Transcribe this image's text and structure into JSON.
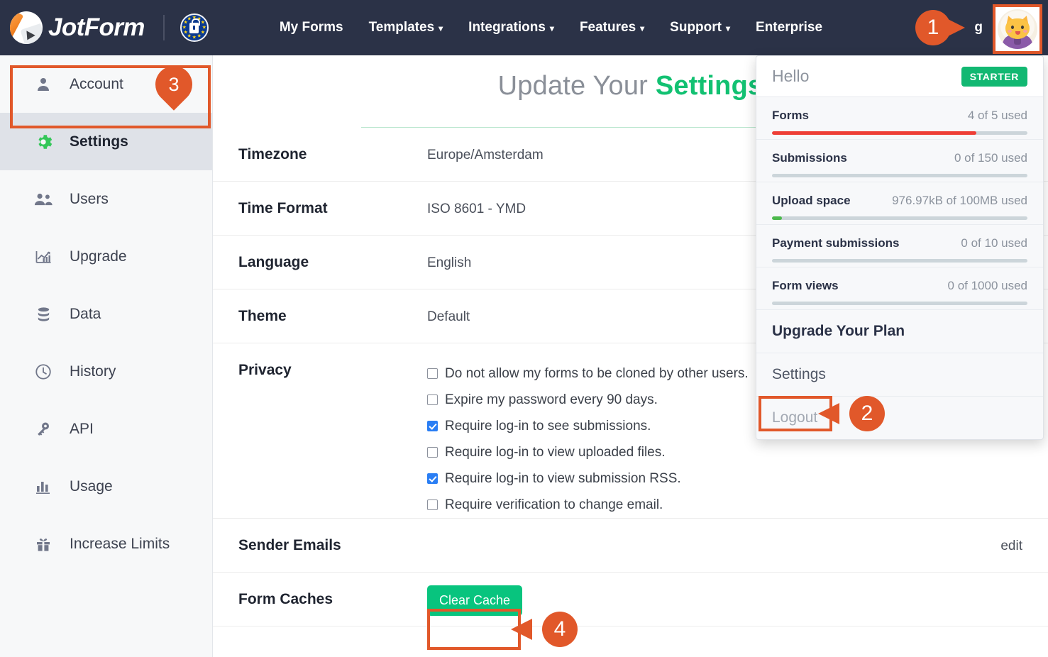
{
  "brand": {
    "name": "JotForm",
    "gdpr_badge": "gdpr-eu-lock"
  },
  "topnav": {
    "links": [
      {
        "label": "My Forms",
        "has_caret": false
      },
      {
        "label": "Templates",
        "has_caret": true
      },
      {
        "label": "Integrations",
        "has_caret": true
      },
      {
        "label": "Features",
        "has_caret": true
      },
      {
        "label": "Support",
        "has_caret": true
      },
      {
        "label": "Enterprise",
        "has_caret": false
      }
    ],
    "username_partial": "g"
  },
  "sidebar": {
    "items": [
      {
        "label": "Account",
        "icon": "person-icon",
        "active": false
      },
      {
        "label": "Settings",
        "icon": "gear-icon",
        "active": true
      },
      {
        "label": "Users",
        "icon": "people-icon",
        "active": false
      },
      {
        "label": "Upgrade",
        "icon": "trending-up-icon",
        "active": false
      },
      {
        "label": "Data",
        "icon": "database-icon",
        "active": false
      },
      {
        "label": "History",
        "icon": "clock-icon",
        "active": false
      },
      {
        "label": "API",
        "icon": "key-icon",
        "active": false
      },
      {
        "label": "Usage",
        "icon": "bar-chart-icon",
        "active": false
      },
      {
        "label": "Increase Limits",
        "icon": "gift-icon",
        "active": false
      }
    ]
  },
  "main": {
    "title_prefix": "Update Your ",
    "title_accent": "Settings",
    "rows": [
      {
        "label": "Timezone",
        "value": "Europe/Amsterdam"
      },
      {
        "label": "Time Format",
        "value": "ISO 8601 - YMD"
      },
      {
        "label": "Language",
        "value": "English"
      },
      {
        "label": "Theme",
        "value": "Default"
      }
    ],
    "privacy": {
      "label": "Privacy",
      "options": [
        {
          "text": "Do not allow my forms to be cloned by other users.",
          "checked": false
        },
        {
          "text": "Expire my password every 90 days.",
          "checked": false
        },
        {
          "text": "Require log-in to see submissions.",
          "checked": true
        },
        {
          "text": "Require log-in to view uploaded files.",
          "checked": false
        },
        {
          "text": "Require log-in to view submission RSS.",
          "checked": true
        },
        {
          "text": "Require verification to change email.",
          "checked": false
        }
      ]
    },
    "sender_emails": {
      "label": "Sender Emails",
      "edit_label": "edit"
    },
    "form_caches": {
      "label": "Form Caches",
      "button_label": "Clear Cache"
    }
  },
  "dropdown": {
    "greeting": "Hello",
    "plan_badge": "STARTER",
    "usage": [
      {
        "name": "Forms",
        "value": "4 of 5 used",
        "percent": 80,
        "color": "#ee3e36"
      },
      {
        "name": "Submissions",
        "value": "0 of 150 used",
        "percent": 0,
        "color": "#12b872"
      },
      {
        "name": "Upload space",
        "value": "976.97kB of 100MB used",
        "percent": 4,
        "color": "#4cb94c"
      },
      {
        "name": "Payment submissions",
        "value": "0 of 10 used",
        "percent": 0,
        "color": "#12b872"
      },
      {
        "name": "Form views",
        "value": "0 of 1000 used",
        "percent": 0,
        "color": "#12b872"
      }
    ],
    "actions": [
      {
        "label": "Upgrade Your Plan",
        "style": "bold"
      },
      {
        "label": "Settings",
        "style": "plain"
      },
      {
        "label": "Logout",
        "style": "muted"
      }
    ]
  },
  "callouts": [
    {
      "number": "1",
      "shape": "arrow-right"
    },
    {
      "number": "2",
      "shape": "arrow-left"
    },
    {
      "number": "3",
      "shape": "pin-down"
    },
    {
      "number": "4",
      "shape": "arrow-left"
    }
  ],
  "colors": {
    "nav_bg": "#2b3247",
    "accent_orange": "#e1582a",
    "accent_green": "#12c172",
    "button_green": "#08c47e",
    "bar_red": "#ee3e36"
  }
}
